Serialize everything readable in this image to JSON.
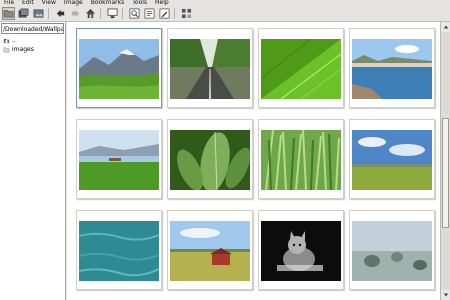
{
  "menubar": [
    "File",
    "Edit",
    "View",
    "Image",
    "Bookmarks",
    "Tools",
    "Help"
  ],
  "toolbar": {
    "icons": [
      "open-folder-icon",
      "stack-icon",
      "image-icon",
      "back-icon",
      "forward-icon",
      "home-icon",
      "monitor-icon",
      "zoom-icon",
      "page-icon",
      "page-edit-icon",
      "gallery-icon"
    ]
  },
  "sidebar": {
    "path": "/Downloaded/Wallpapers",
    "tree": [
      {
        "label": "..",
        "icon": "folder-up-icon"
      },
      {
        "label": "images",
        "icon": "folder-icon"
      }
    ]
  },
  "thumbnails": [
    {
      "name": "mountain-meadow",
      "selected": true
    },
    {
      "name": "tree-lined-road",
      "selected": false
    },
    {
      "name": "green-leaf-macro",
      "selected": false
    },
    {
      "name": "seaside-town",
      "selected": false
    },
    {
      "name": "lake-and-field",
      "selected": false
    },
    {
      "name": "green-leaves",
      "selected": false
    },
    {
      "name": "grass-closeup",
      "selected": false
    },
    {
      "name": "field-and-clouds",
      "selected": false
    },
    {
      "name": "turquoise-water",
      "selected": false
    },
    {
      "name": "red-barn-field",
      "selected": false
    },
    {
      "name": "black-white-kitten",
      "selected": false
    },
    {
      "name": "misty-trees",
      "selected": false
    }
  ],
  "colors": {
    "selection": "#7a95b5",
    "sky": "#7fb0e0",
    "grass": "#5b9a2e"
  }
}
